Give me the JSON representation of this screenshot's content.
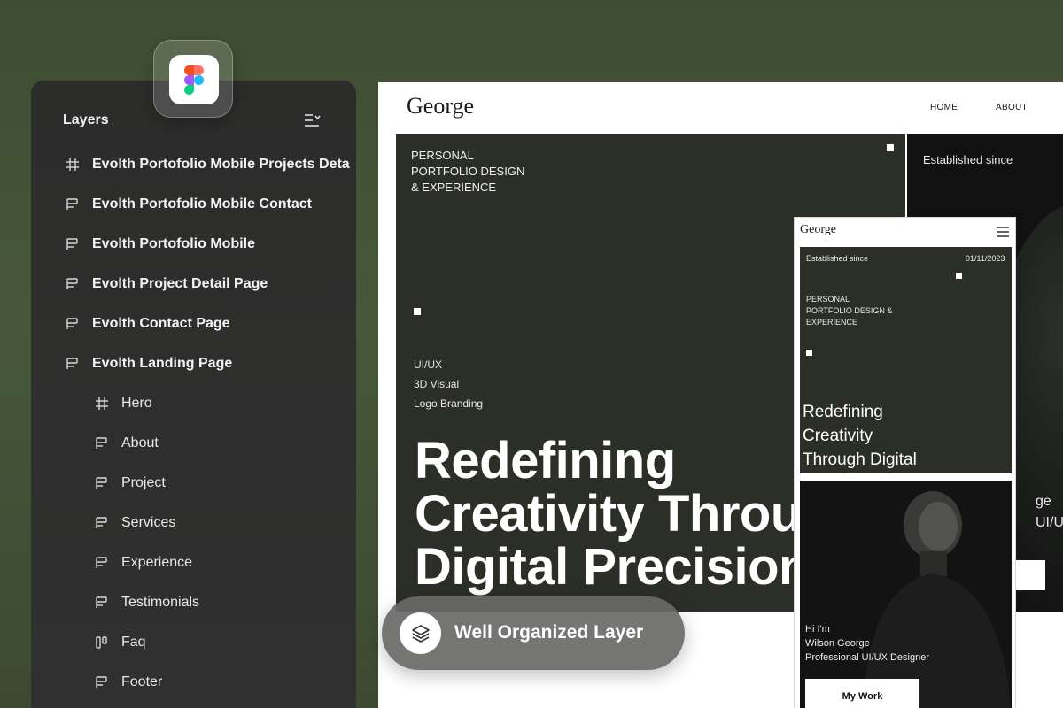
{
  "layers_panel": {
    "title": "Layers",
    "toggle_icon": "list-collapse-icon",
    "items": [
      {
        "label": "Evolth Portofolio Mobile Projects Deta",
        "icon": "frame-icon",
        "level": 0
      },
      {
        "label": "Evolth Portofolio Mobile Contact",
        "icon": "section-icon",
        "level": 0
      },
      {
        "label": "Evolth Portofolio Mobile",
        "icon": "section-icon",
        "level": 0
      },
      {
        "label": "Evolth Project Detail Page",
        "icon": "section-icon",
        "level": 0
      },
      {
        "label": "Evolth Contact Page",
        "icon": "section-icon",
        "level": 0
      },
      {
        "label": "Evolth Landing Page",
        "icon": "section-icon",
        "level": 0
      },
      {
        "label": "Hero",
        "icon": "frame-icon",
        "level": 1
      },
      {
        "label": "About",
        "icon": "section-icon",
        "level": 1
      },
      {
        "label": "Project",
        "icon": "section-icon",
        "level": 1
      },
      {
        "label": "Services",
        "icon": "section-icon",
        "level": 1
      },
      {
        "label": "Experience",
        "icon": "section-icon",
        "level": 1
      },
      {
        "label": "Testimonials",
        "icon": "section-icon",
        "level": 1
      },
      {
        "label": "Faq",
        "icon": "columns-icon",
        "level": 1
      },
      {
        "label": "Footer",
        "icon": "section-icon",
        "level": 1
      }
    ]
  },
  "app_badge": {
    "icon": "figma-logo-icon"
  },
  "desktop": {
    "logo": "George",
    "nav": [
      "HOME",
      "ABOUT"
    ],
    "hero_tag": "PERSONAL\nPORTFOLIO DESIGN\n& EXPERIENCE",
    "services": [
      "UI/UX",
      "3D Visual",
      "Logo Branding"
    ],
    "headline": "Redefining\nCreativity Throu\nDigital Precision",
    "right_panel": {
      "established": "Established since",
      "fragments": [
        "ge",
        "UI/UX"
      ]
    }
  },
  "mobile": {
    "logo": "George",
    "menu_icon": "hamburger-menu-icon",
    "established": "Established since",
    "date": "01/11/2023",
    "tag": "PERSONAL\nPORTFOLIO DESIGN &\nEXPERIENCE",
    "headline": "Redefining\nCreativity\nThrough Digital",
    "intro": "Hi I'm\nWilson George\nProfessional UI/UX Designer",
    "button": "My Work"
  },
  "feature_pill": {
    "label": "Well Organized Layer",
    "icon": "layers-stack-icon"
  },
  "colors": {
    "background": "#435237",
    "panel": "#2e2e2e",
    "hero_dark": "#2b2f27",
    "pill": "#696967"
  }
}
